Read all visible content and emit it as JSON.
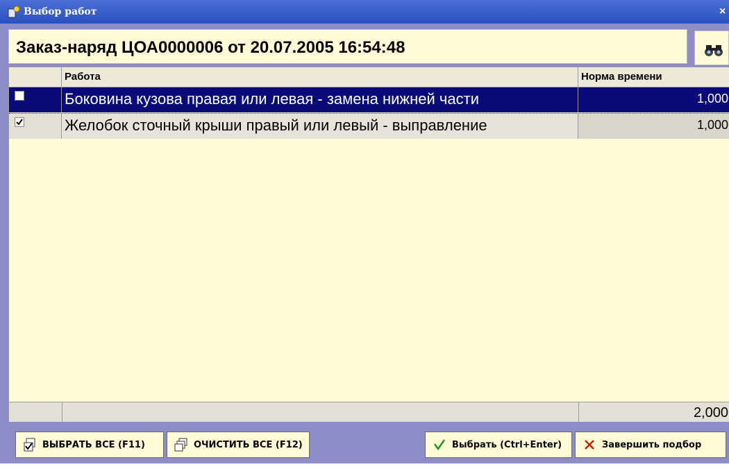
{
  "window": {
    "title": "Выбор работ",
    "close_glyph": "×"
  },
  "order": {
    "title": "Заказ-наряд ЦОА0000006 от 20.07.2005 16:54:48"
  },
  "table": {
    "columns": {
      "check": "",
      "name": "Работа",
      "time": "Норма времени"
    },
    "rows": [
      {
        "checked": false,
        "selected": true,
        "name": "Боковина кузова правая или левая - замена нижней части",
        "time": "1,000"
      },
      {
        "checked": true,
        "selected": false,
        "name": "Желобок сточный крыши правый или левый - выправление",
        "time": "1,000"
      }
    ],
    "total": "2,000"
  },
  "buttons": {
    "select_all": "ВЫБРАТЬ ВСЕ (F11)",
    "clear_all": "ОЧИСТИТЬ ВСЕ (F12)",
    "choose": "Выбрать (Ctrl+Enter)",
    "finish": "Завершить подбор"
  },
  "icons": {
    "title": "app-icon",
    "search": "binoculars-icon",
    "select_all": "checkboxes-icon",
    "clear_all": "windows-icon",
    "choose": "checkmark-icon",
    "finish": "cross-icon"
  },
  "colors": {
    "selection": "#0a0a78",
    "background": "#8c8cc6",
    "grid_bg": "#fffbd6",
    "check_green": "#1a9a1a",
    "cross_red": "#cc2200"
  }
}
